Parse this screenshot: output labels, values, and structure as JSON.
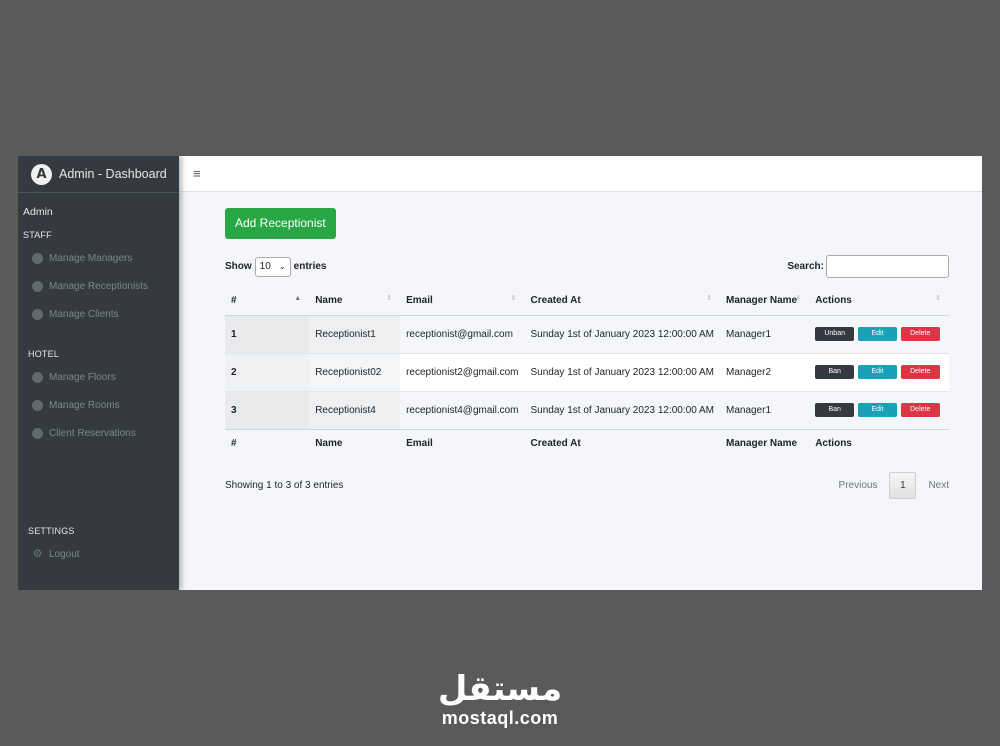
{
  "sidebar": {
    "brand_icon_letter": "A",
    "brand_title": "Admin - Dashboard",
    "user": "Admin",
    "sections": [
      {
        "title": "STAFF",
        "items": [
          "Manage Managers",
          "Manage Receptionists",
          "Manage Clients"
        ]
      },
      {
        "title": "HOTEL",
        "items": [
          "Manage Floors",
          "Manage Rooms",
          "Client Reservations"
        ]
      },
      {
        "title": "SETTINGS",
        "items": [
          "Logout"
        ]
      }
    ],
    "icons": {
      "nav": "circle-icon",
      "logout": "gear-icon"
    }
  },
  "topbar": {
    "menu_icon": "hamburger-icon",
    "menu_glyph": "≡"
  },
  "main": {
    "add_button": "Add Receptionist",
    "show_label": "Show",
    "entries_value": "10",
    "entries_label": "entries",
    "search_label": "Search:",
    "search_value": "",
    "columns": [
      "#",
      "Name",
      "Email",
      "Created At",
      "Manager Name",
      "Actions"
    ],
    "rows": [
      {
        "id": "1",
        "name": "Receptionist1",
        "email": "receptionist@gmail.com",
        "created_at": "Sunday 1st of January 2023 12:00:00 AM",
        "manager": "Manager1",
        "ban_label": "Unban",
        "edit_label": "Edit",
        "delete_label": "Delete"
      },
      {
        "id": "2",
        "name": "Receptionist02",
        "email": "receptionist2@gmail.com",
        "created_at": "Sunday 1st of January 2023 12:00:00 AM",
        "manager": "Manager2",
        "ban_label": "Ban",
        "edit_label": "Edit",
        "delete_label": "Delete"
      },
      {
        "id": "3",
        "name": "Receptionist4",
        "email": "receptionist4@gmail.com",
        "created_at": "Sunday 1st of January 2023 12:00:00 AM",
        "manager": "Manager1",
        "ban_label": "Ban",
        "edit_label": "Edit",
        "delete_label": "Delete"
      }
    ],
    "info": "Showing 1 to 3 of 3 entries",
    "pagination": {
      "previous": "Previous",
      "current": "1",
      "next": "Next"
    }
  },
  "colors": {
    "sidebar_bg": "#343a40",
    "success": "#28a745",
    "info": "#17a2b8",
    "danger": "#dc3545",
    "dark": "#343a40",
    "content_bg": "#f4f6f9"
  },
  "watermark": {
    "arabic": "مستقل",
    "latin": "mostaql.com"
  }
}
